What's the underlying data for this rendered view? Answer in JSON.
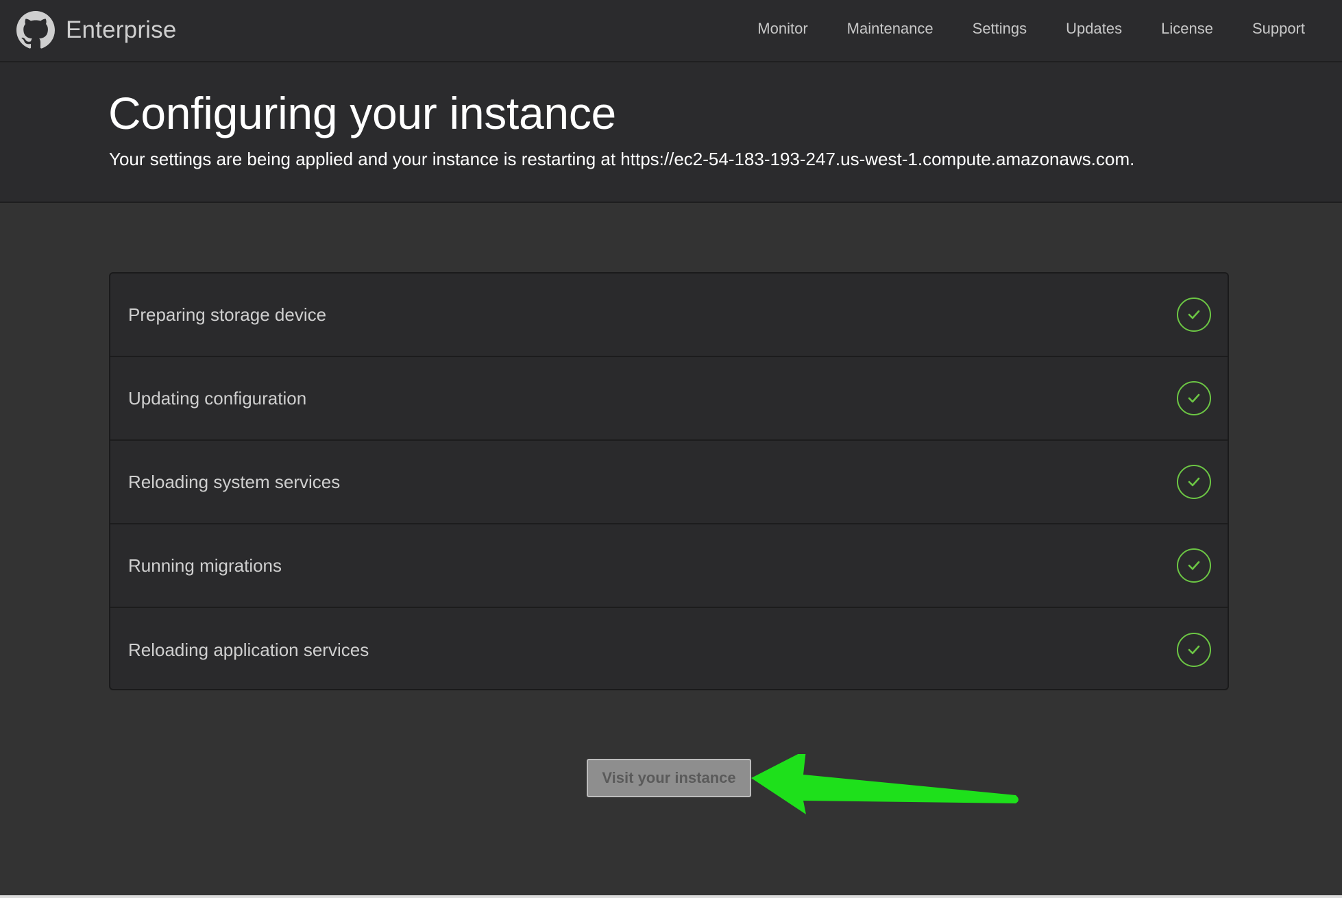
{
  "brand": {
    "name": "Enterprise",
    "icon": "github-octocat-icon"
  },
  "nav": {
    "items": [
      {
        "label": "Monitor"
      },
      {
        "label": "Maintenance"
      },
      {
        "label": "Settings"
      },
      {
        "label": "Updates"
      },
      {
        "label": "License"
      },
      {
        "label": "Support"
      }
    ]
  },
  "header": {
    "title": "Configuring your instance",
    "subtitle_prefix": "Your settings are being applied and your instance is restarting at ",
    "subtitle_url": "https://ec2-54-183-193-247.us-west-1.compute.amazonaws.com",
    "subtitle_suffix": "."
  },
  "steps": [
    {
      "label": "Preparing storage device",
      "status": "complete",
      "icon": "check-circle-icon"
    },
    {
      "label": "Updating configuration",
      "status": "complete",
      "icon": "check-circle-icon"
    },
    {
      "label": "Reloading system services",
      "status": "complete",
      "icon": "check-circle-icon"
    },
    {
      "label": "Running migrations",
      "status": "complete",
      "icon": "check-circle-icon"
    },
    {
      "label": "Reloading application services",
      "status": "complete",
      "icon": "check-circle-icon"
    }
  ],
  "actions": {
    "visit_label": "Visit your instance"
  },
  "annotation": {
    "icon": "arrow-left-icon",
    "color": "#1ee01b"
  },
  "colors": {
    "background": "#333333",
    "topbar": "#2b2b2d",
    "success": "#6cc644",
    "button": "#8e8e8e"
  }
}
